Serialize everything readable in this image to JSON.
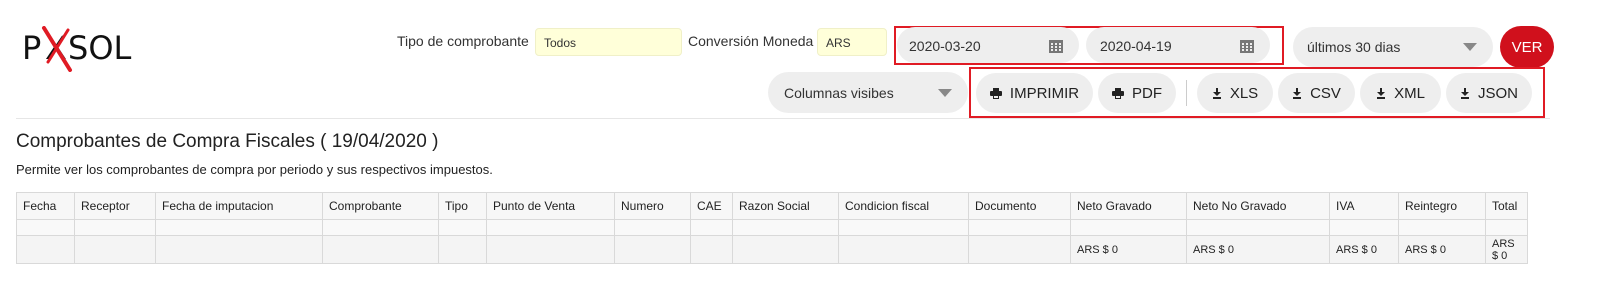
{
  "brand": {
    "logo_text_left": "P",
    "logo_text_x": "X",
    "logo_text_right": "SOL",
    "accent": "#e01b24"
  },
  "filters": {
    "tipo_label": "Tipo de comprobante",
    "tipo_value": "Todos",
    "moneda_label": "Conversión Moneda",
    "moneda_value": "ARS",
    "date_from": "2020-03-20",
    "date_to": "2020-04-19",
    "period_value": "últimos 30 dias",
    "ver_label": "VER",
    "columns_label": "Columnas visibes"
  },
  "actions": {
    "imprimir": "IMPRIMIR",
    "pdf": "PDF",
    "xls": "XLS",
    "csv": "CSV",
    "xml": "XML",
    "json": "JSON"
  },
  "page": {
    "title": "Comprobantes de Compra Fiscales ( 19/04/2020 )",
    "description": "Permite ver los comprobantes de compra por periodo y sus respectivos impuestos."
  },
  "table": {
    "headers": [
      "Fecha",
      "Receptor",
      "Fecha de imputacion",
      "Comprobante",
      "Tipo",
      "Punto de Venta",
      "Numero",
      "CAE",
      "Razon Social",
      "Condicion fiscal",
      "Documento",
      "Neto Gravado",
      "Neto No Gravado",
      "IVA",
      "Reintegro",
      "Total"
    ],
    "totals": [
      "",
      "",
      "",
      "",
      "",
      "",
      "",
      "",
      "",
      "",
      "",
      "ARS $ 0",
      "ARS $ 0",
      "ARS $ 0",
      "ARS $ 0",
      "ARS $ 0"
    ]
  }
}
